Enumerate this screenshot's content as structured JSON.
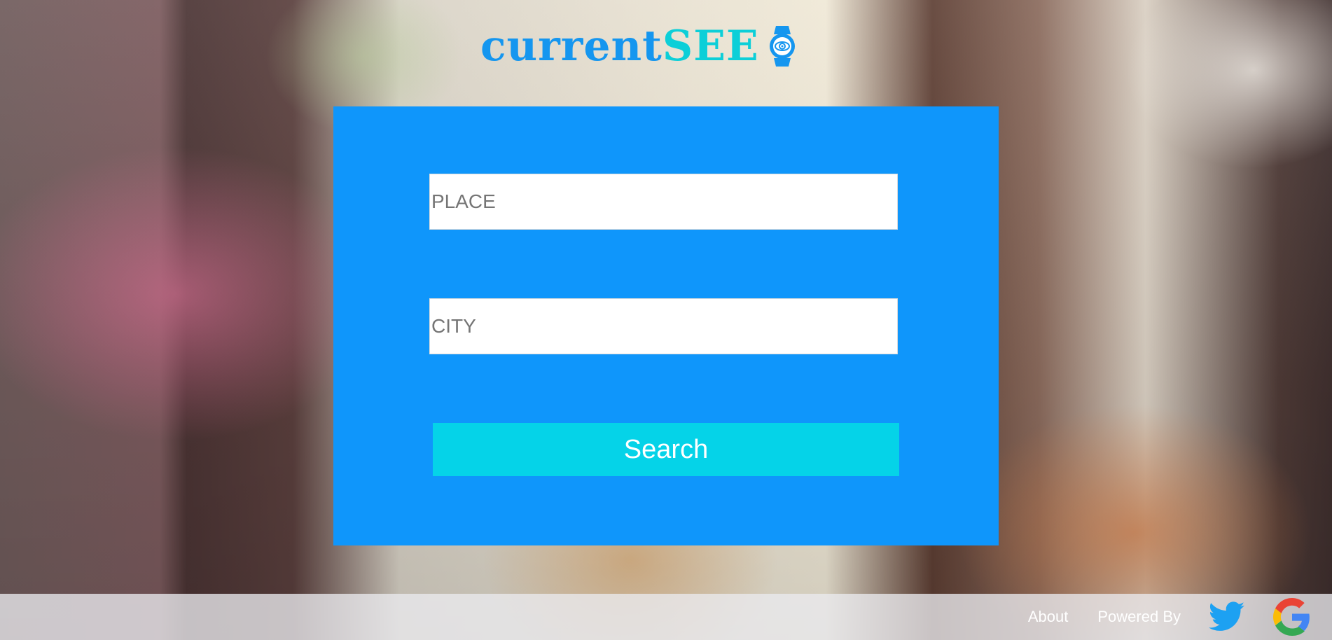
{
  "logo": {
    "part1": "current",
    "part2": "SEE",
    "icon": "watch-eye-icon"
  },
  "form": {
    "place_placeholder": "PLACE",
    "city_placeholder": "CITY",
    "search_label": "Search"
  },
  "footer": {
    "about_label": "About",
    "powered_by_label": "Powered By",
    "icons": [
      "twitter-icon",
      "google-icon"
    ]
  },
  "colors": {
    "card": "#0f96fb",
    "button": "#05d3e8",
    "logo_primary": "#1596ef",
    "logo_accent": "#0ccfd8"
  }
}
